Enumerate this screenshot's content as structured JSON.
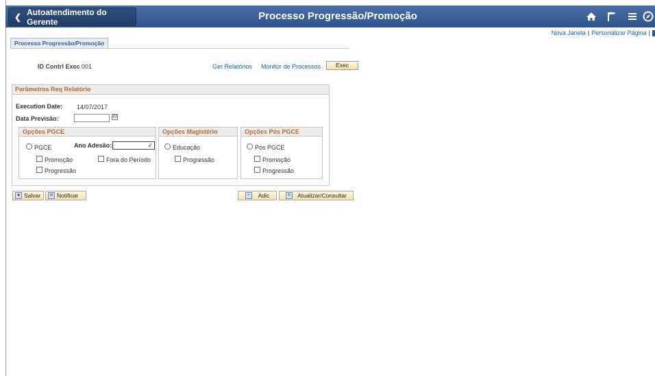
{
  "header": {
    "back_label": "Autoatendimento do Gerente",
    "title": "Processo Progressão/Promoção"
  },
  "top_links": {
    "new_window": "Nova Janela",
    "personalize": "Personalizar Página",
    "separator": "|"
  },
  "tab": {
    "label": "Processo Progressão/Promoção"
  },
  "run_control": {
    "id_label": "ID Contrl Exec",
    "id_value": "001",
    "reports_link": "Ger Relatórios",
    "monitor_link": "Monitor de Processos",
    "exec_label": "Exec"
  },
  "params": {
    "title": "Parâmetros Req Relatório",
    "execution_date_label": "Execution Date:",
    "execution_date_value": "14/07/2017",
    "forecast_date_label": "Data Previsão:",
    "forecast_date_value": ""
  },
  "pgce": {
    "title": "Opções PGCE",
    "radio_label": "PGCE",
    "year_label": "Ano Adesão:",
    "year_value": "",
    "promocao": "Promoção",
    "fora_periodo": "Fora do Período",
    "progressao": "Progressão"
  },
  "magisterio": {
    "title": "Opções Magistério",
    "radio_label": "Educação",
    "progressao": "Progressão"
  },
  "pos_pgce": {
    "title": "Opções Pós PGCE",
    "radio_label": "Pós PGCE",
    "promocao": "Promoção",
    "progressao": "Progressão"
  },
  "buttons": {
    "salvar": "Salvar",
    "notificar": "Notificar",
    "adic": "Adic",
    "atualizar": "Atualizar/Consultar"
  },
  "icons": [
    "chevron-left-icon",
    "home-icon",
    "flag-icon",
    "menu-icon",
    "compass-icon",
    "calendar-icon",
    "save-icon",
    "notify-icon",
    "add-icon",
    "refresh-icon"
  ],
  "colors": {
    "banner": "#2e548d",
    "link": "#1c5ea5",
    "section_header": "#b86a2a"
  }
}
